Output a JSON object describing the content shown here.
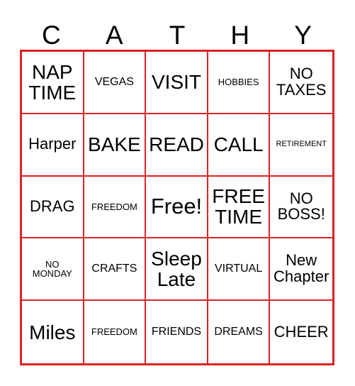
{
  "card": {
    "title_letters": [
      "C",
      "A",
      "T",
      "H",
      "Y"
    ],
    "border_color": "#dd2222",
    "text_color": "#000000",
    "background_color": "#ffffff",
    "columns": 5,
    "rows": 5,
    "cells": [
      {
        "text": "NAP\nTIME",
        "size": "s-lg"
      },
      {
        "text": "VEGAS",
        "size": "s-sm"
      },
      {
        "text": "VISIT",
        "size": "s-lg"
      },
      {
        "text": "HOBBIES",
        "size": "s-xs"
      },
      {
        "text": "NO\nTAXES",
        "size": "s-md"
      },
      {
        "text": "Harper",
        "size": "s-md"
      },
      {
        "text": "BAKE",
        "size": "s-lg"
      },
      {
        "text": "READ",
        "size": "s-lg"
      },
      {
        "text": "CALL",
        "size": "s-lg"
      },
      {
        "text": "RETIREMENT",
        "size": "s-xxs"
      },
      {
        "text": "DRAG",
        "size": "s-md"
      },
      {
        "text": "FREEDOM",
        "size": "s-xs"
      },
      {
        "text": "Free!",
        "size": "s-xl"
      },
      {
        "text": "FREE\nTIME",
        "size": "s-lg"
      },
      {
        "text": "NO\nBOSS!",
        "size": "s-md"
      },
      {
        "text": "NO\nMONDAY",
        "size": "s-xs"
      },
      {
        "text": "CRAFTS",
        "size": "s-sm"
      },
      {
        "text": "Sleep\nLate",
        "size": "s-lg"
      },
      {
        "text": "VIRTUAL",
        "size": "s-sm"
      },
      {
        "text": "New\nChapter",
        "size": "s-md"
      },
      {
        "text": "Miles",
        "size": "s-lg"
      },
      {
        "text": "FREEDOM",
        "size": "s-xs"
      },
      {
        "text": "FRIENDS",
        "size": "s-sm"
      },
      {
        "text": "DREAMS",
        "size": "s-sm"
      },
      {
        "text": "CHEER",
        "size": "s-md"
      }
    ]
  }
}
